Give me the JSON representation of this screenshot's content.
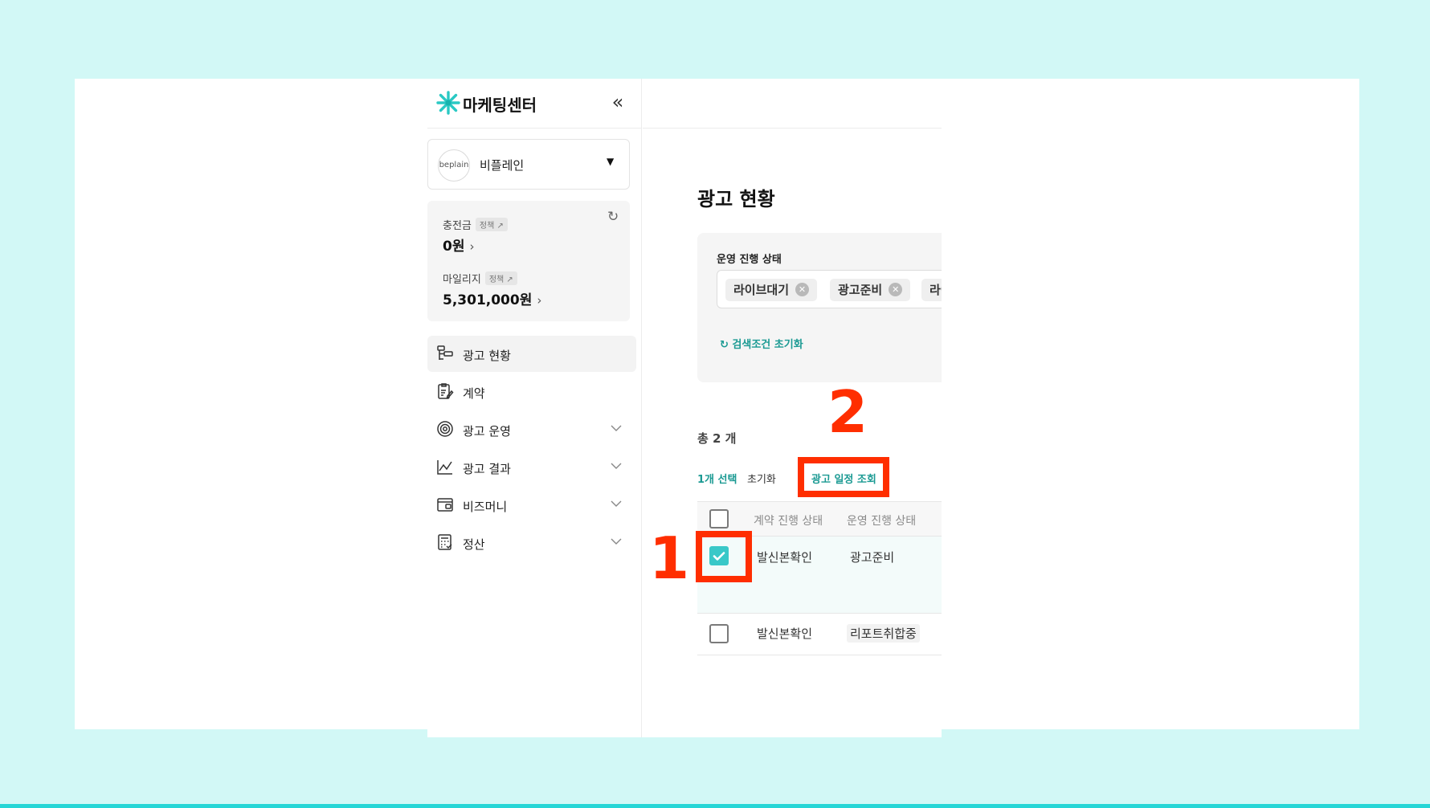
{
  "sidebar": {
    "logo_text": "마케팅센터",
    "collapse_glyph": "«",
    "account": {
      "avatar_text": "beplain",
      "name": "비플레인"
    },
    "balance": {
      "charge_label": "충전금",
      "charge_policy": "정책 ↗",
      "charge_value": "0원",
      "mileage_label": "마일리지",
      "mileage_policy": "정책 ↗",
      "mileage_value": "5,301,000원"
    },
    "menu": [
      {
        "label": "광고 현황",
        "icon": "ad-status-icon"
      },
      {
        "label": "계약",
        "icon": "contract-icon"
      },
      {
        "label": "광고 운영",
        "icon": "ad-operation-icon"
      },
      {
        "label": "광고 결과",
        "icon": "chart-icon"
      },
      {
        "label": "비즈머니",
        "icon": "wallet-icon"
      },
      {
        "label": "정산",
        "icon": "calculator-icon"
      }
    ]
  },
  "main": {
    "title": "광고 현황",
    "filter": {
      "label": "운영 진행 상태",
      "chips": [
        "라이브대기",
        "광고준비",
        "라이"
      ],
      "reset_label": "검색조건 초기화"
    },
    "total_text": "총 2 개",
    "selection": {
      "count_label": "1개 선택",
      "reset_label": "초기화",
      "schedule_label": "광고 일정 조회"
    },
    "table": {
      "headers": [
        "계약 진행 상태",
        "운영 진행 상태"
      ],
      "rows": [
        {
          "contract_status": "발신본확인",
          "operation_status": "광고준비",
          "checked": true
        },
        {
          "contract_status": "발신본확인",
          "operation_status": "리포트취합중",
          "checked": false
        }
      ]
    }
  },
  "annotations": {
    "step1": "1",
    "step2": "2",
    "color": "#ff2e00"
  },
  "colors": {
    "background": "#d2f8f6",
    "accent_teal": "#1b9a93",
    "checkbox_checked": "#39c8c8"
  }
}
